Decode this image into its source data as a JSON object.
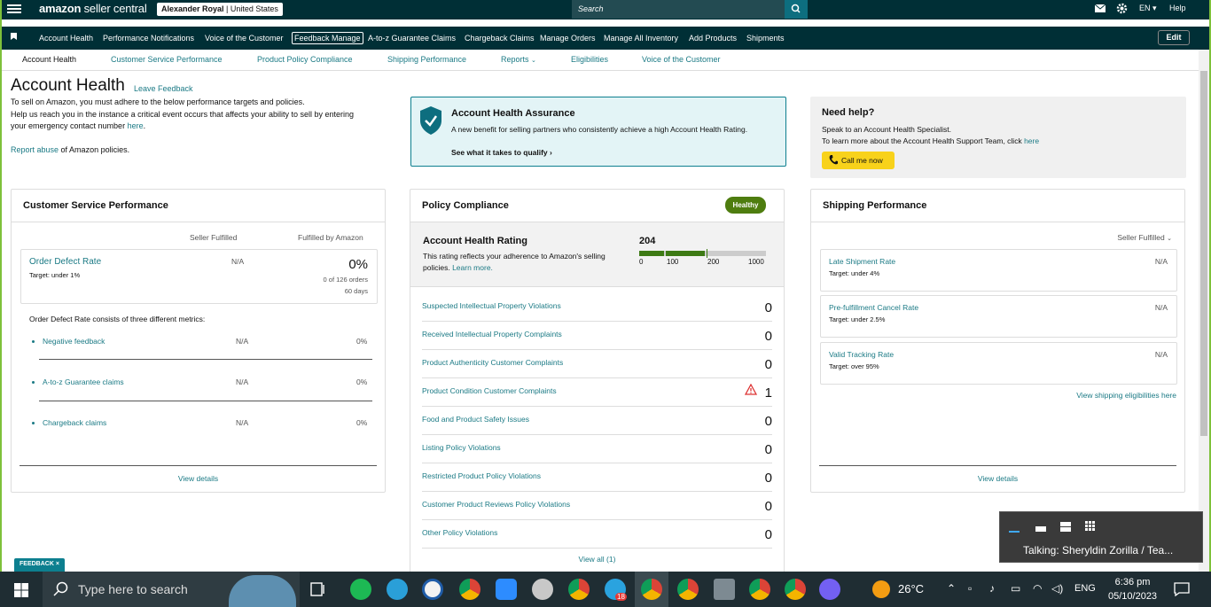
{
  "topbar": {
    "logo_bold": "amazon",
    "logo_rest": " seller central",
    "account_name": "Alexander Royal",
    "marketplace": "| United States",
    "search_placeholder": "Search",
    "language": "EN",
    "help": "Help"
  },
  "nav": {
    "items": [
      "Account Health",
      "Performance Notifications",
      "Voice of the Customer",
      "Feedback Manage",
      "A-to-z Guarantee Claims",
      "Chargeback Claims",
      "Manage Orders",
      "Manage All Inventory",
      "Add Products",
      "Shipments"
    ],
    "edit": "Edit"
  },
  "subtabs": [
    "Account Health",
    "Customer Service Performance",
    "Product Policy Compliance",
    "Shipping Performance",
    "Reports",
    "Eligibilities",
    "Voice of the Customer"
  ],
  "header": {
    "title": "Account Health",
    "leave_feedback": "Leave Feedback",
    "line1": "To sell on Amazon, you must adhere to the below performance targets and policies.",
    "line2": "Help us reach you in the instance a critical event occurs that affects your ability to sell by entering",
    "line3_text": "your emergency contact number ",
    "line3_link": "here",
    "line3_end": ".",
    "report_link": "Report abuse",
    "report_text": " of Amazon policies."
  },
  "assurance": {
    "title": "Account Health Assurance",
    "text": "A new benefit for selling partners who consistently achieve a high Account Health Rating.",
    "link": "See what it takes to qualify"
  },
  "need_help": {
    "title": "Need help?",
    "line1": "Speak to an Account Health Specialist.",
    "line2": "To learn more about the Account Health Support Team, click ",
    "line2_link": "here",
    "button": "Call me now"
  },
  "csp": {
    "title": "Customer Service Performance",
    "col1": "Seller Fulfilled",
    "col2": "Fulfilled by Amazon",
    "odr_label": "Order Defect Rate",
    "odr_target": "Target: under 1%",
    "odr_seller": "N/A",
    "odr_fba": "0%",
    "odr_orders": "0 of 126 orders",
    "odr_days": "60 days",
    "metrics_intro": "Order Defect Rate consists of three different metrics:",
    "metrics": [
      {
        "label": "Negative feedback",
        "seller": "N/A",
        "fba": "0%"
      },
      {
        "label": "A-to-z Guarantee claims",
        "seller": "N/A",
        "fba": "0%"
      },
      {
        "label": "Chargeback claims",
        "seller": "N/A",
        "fba": "0%"
      }
    ],
    "view_details": "View details"
  },
  "policy": {
    "title": "Policy Compliance",
    "badge": "Healthy",
    "rating_title": "Account Health Rating",
    "rating_text": "This rating reflects your adherence to Amazon's selling policies. ",
    "rating_link": "Learn more.",
    "rating_value": "204",
    "scale": [
      "0",
      "100",
      "200",
      "1000"
    ],
    "rows": [
      {
        "label": "Suspected Intellectual Property Violations",
        "value": "0"
      },
      {
        "label": "Received Intellectual Property Complaints",
        "value": "0"
      },
      {
        "label": "Product Authenticity Customer Complaints",
        "value": "0"
      },
      {
        "label": "Product Condition Customer Complaints",
        "value": "1"
      },
      {
        "label": "Food and Product Safety Issues",
        "value": "0"
      },
      {
        "label": "Listing Policy Violations",
        "value": "0"
      },
      {
        "label": "Restricted Product Policy Violations",
        "value": "0"
      },
      {
        "label": "Customer Product Reviews Policy Violations",
        "value": "0"
      },
      {
        "label": "Other Policy Violations",
        "value": "0"
      }
    ],
    "view_all": "View all (1)"
  },
  "shipping": {
    "title": "Shipping Performance",
    "filter": "Seller Fulfilled",
    "metrics": [
      {
        "label": "Late Shipment Rate",
        "target": "Target: under 4%",
        "value": "N/A"
      },
      {
        "label": "Pre-fulfillment Cancel Rate",
        "target": "Target: under 2.5%",
        "value": "N/A"
      },
      {
        "label": "Valid Tracking Rate",
        "target": "Target: over 95%",
        "value": "N/A"
      }
    ],
    "eligibilities_link": "View shipping eligibilities here",
    "view_details": "View details"
  },
  "feedback_tag": "FEEDBACK ×",
  "talking_popup": "Talking: Sheryldin Zorilla / Tea...",
  "taskbar": {
    "search_text": "Type here to search",
    "weather": "26°C",
    "language": "ENG",
    "time": "6:36 pm",
    "date": "05/10/2023",
    "telegram_badge": "18"
  },
  "colors": {
    "header_bg": "#002f36",
    "link": "#1b7a85",
    "healthy": "#4e7d0f",
    "call_button": "#f8d21b",
    "desktop_border": "#7ec13a"
  }
}
